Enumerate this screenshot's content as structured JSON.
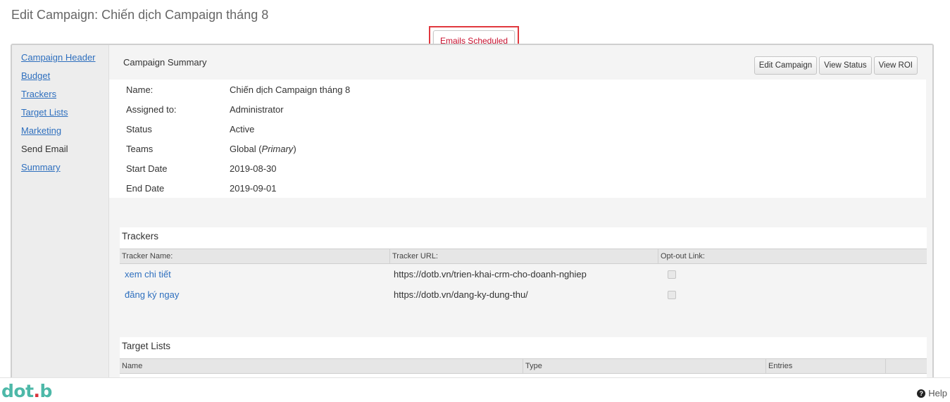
{
  "page": {
    "title": "Edit Campaign: Chiến dịch Campaign tháng 8"
  },
  "notice": {
    "label": "Emails Scheduled"
  },
  "sidebar": {
    "items": [
      {
        "label": "Campaign Header",
        "link": true
      },
      {
        "label": "Budget",
        "link": true
      },
      {
        "label": "Trackers",
        "link": true
      },
      {
        "label": "Target Lists",
        "link": true
      },
      {
        "label": "Marketing",
        "link": true
      },
      {
        "label": "Send Email",
        "link": false
      },
      {
        "label": "Summary",
        "link": true
      }
    ]
  },
  "summary": {
    "title": "Campaign Summary",
    "buttons": {
      "edit": "Edit Campaign",
      "status": "View Status",
      "roi": "View ROI"
    },
    "fields": [
      {
        "label": "Name:",
        "value": "Chiến dịch Campaign tháng 8"
      },
      {
        "label": "Assigned to:",
        "value": "Administrator"
      },
      {
        "label": "Status",
        "value": "Active"
      },
      {
        "label": "Teams",
        "value": "Global (",
        "value_em": "Primary",
        "value_end": ")"
      },
      {
        "label": "Start Date",
        "value": "2019-08-30"
      },
      {
        "label": "End Date",
        "value": "2019-09-01"
      }
    ]
  },
  "trackers": {
    "title": "Trackers",
    "columns": [
      "Tracker Name:",
      "Tracker URL:",
      "Opt-out Link:"
    ],
    "rows": [
      {
        "name": "xem chi tiết",
        "url": "https://dotb.vn/trien-khai-crm-cho-doanh-nghiep",
        "optout": false
      },
      {
        "name": "đăng ký ngay",
        "url": "https://dotb.vn/dang-ky-dung-thu/",
        "optout": false
      }
    ]
  },
  "target_lists": {
    "title": "Target Lists",
    "columns": [
      "Name",
      "Type",
      "Entries"
    ]
  },
  "footer": {
    "logo": {
      "part1": "dot",
      "dot": ".",
      "part2": "b"
    },
    "help": "Help"
  },
  "colors": {
    "link": "#2e6fbe",
    "notice_border": "#e0383e",
    "notice_text": "#c8102e",
    "logo": "#4db8a8",
    "logo_dot": "#d9323a"
  },
  "icons": {
    "help": "question-circle-icon",
    "checkbox": "checkbox-icon"
  }
}
